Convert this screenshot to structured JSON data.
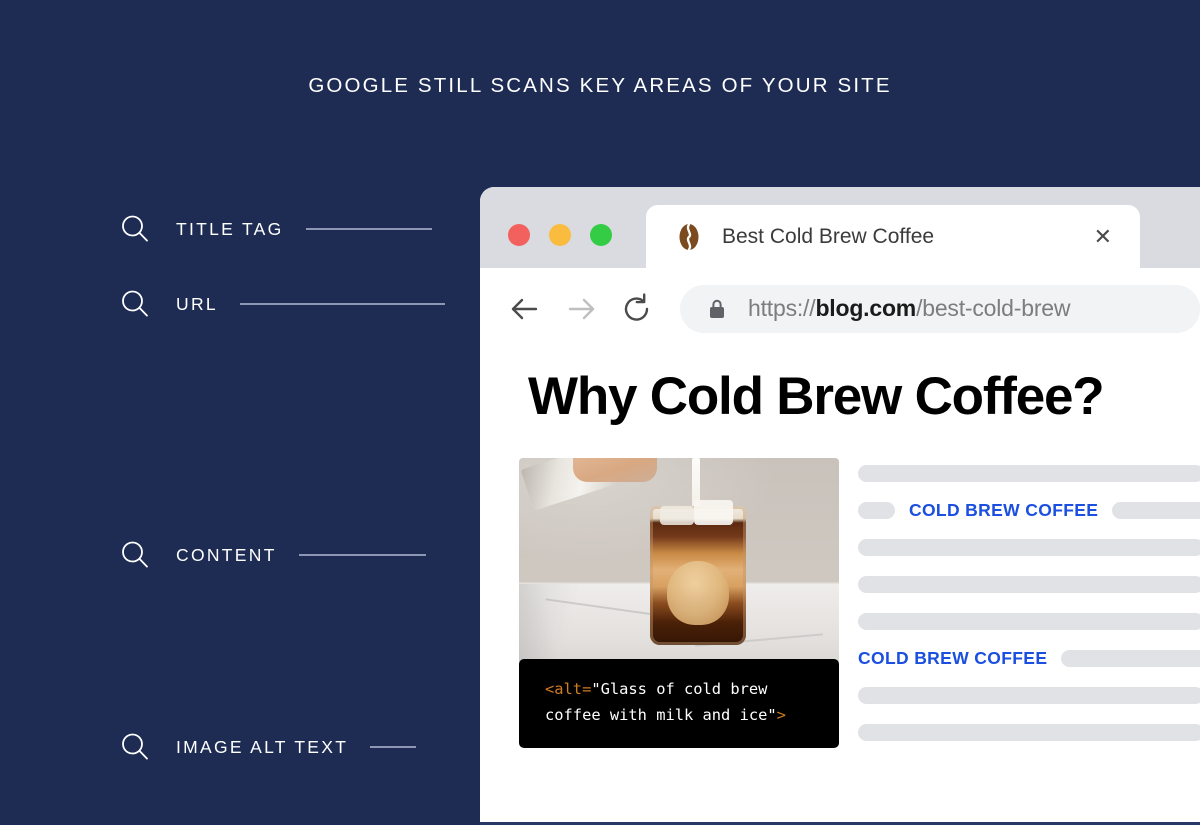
{
  "headline": "GOOGLE STILL SCANS KEY AREAS OF YOUR SITE",
  "theme": {
    "navy": "#1e2c54",
    "connector": "#8d97b5",
    "keyword_blue": "#1a4fe0",
    "skeleton_gray": "#e0e2e6",
    "code_orange": "#d07c22"
  },
  "checklist": {
    "items": [
      {
        "icon": "magnifier-icon",
        "label": "TITLE TAG"
      },
      {
        "icon": "magnifier-icon",
        "label": "URL"
      },
      {
        "icon": "magnifier-icon",
        "label": "CONTENT"
      },
      {
        "icon": "magnifier-icon",
        "label": "IMAGE ALT TEXT"
      }
    ]
  },
  "browser": {
    "window_controls": [
      {
        "name": "close-window-button",
        "color": "#f2615e"
      },
      {
        "name": "minimize-window-button",
        "color": "#fabc3e"
      },
      {
        "name": "maximize-window-button",
        "color": "#34cc44"
      }
    ],
    "tab": {
      "favicon": "coffee-bean-icon",
      "title": "Best Cold Brew Coffee",
      "close_label": "✕"
    },
    "toolbar": {
      "back_icon": "arrow-left-icon",
      "forward_icon": "arrow-right-icon",
      "reload_icon": "reload-icon",
      "lock_icon": "lock-icon",
      "url": {
        "scheme": "https://",
        "host": "blog.com",
        "path": "/best-cold-brew"
      }
    }
  },
  "page": {
    "title": "Why Cold Brew Coffee?",
    "image": {
      "name": "cold-brew-photo",
      "description": "Glass jar of cold brew coffee with milk being poured and ice"
    },
    "alt_code": {
      "open_tag": "<alt=",
      "value": "\"Glass of cold brew coffee with milk and ice\"",
      "close_tag": ">",
      "line1_value": "\"Glass of cold brew",
      "line2_value": "coffee with milk and ice\""
    },
    "skeleton_rows": [
      {
        "type": "bar"
      },
      {
        "type": "keyword-inline",
        "lead_bar": true,
        "keyword": "COLD BREW COFFEE",
        "trail_bar": true
      },
      {
        "type": "bar"
      },
      {
        "type": "bar"
      },
      {
        "type": "bar"
      },
      {
        "type": "keyword-inline",
        "lead_bar": false,
        "keyword": "COLD BREW COFFEE",
        "trail_bar": true
      },
      {
        "type": "bar"
      },
      {
        "type": "bar"
      }
    ]
  }
}
